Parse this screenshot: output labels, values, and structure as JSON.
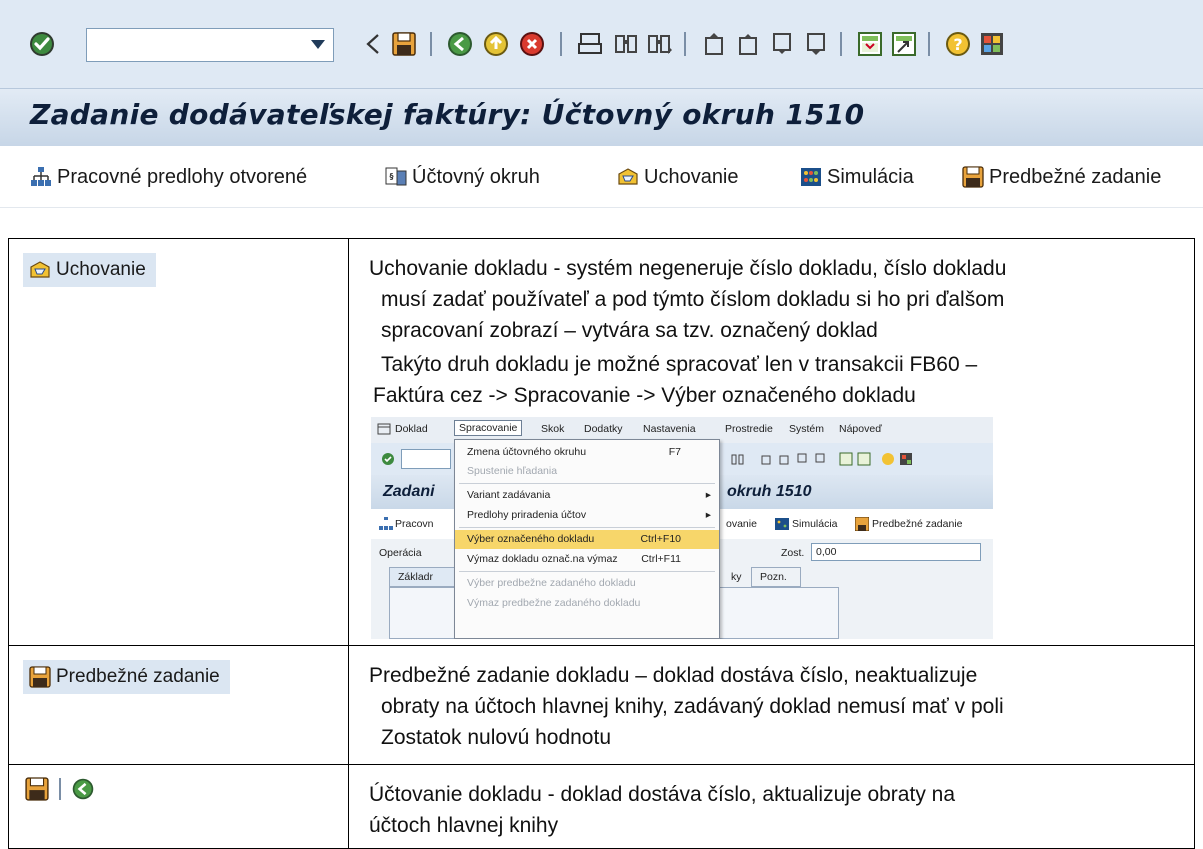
{
  "window": {
    "title": "Zadanie dodávateľskej faktúry: Účtovný okruh 1510"
  },
  "toolbar": {
    "command_value": "",
    "icons": [
      "enter-icon",
      "back-icon",
      "save-icon",
      "back-green-icon",
      "exit-icon",
      "cancel-icon",
      "print-icon",
      "find-icon",
      "find-next-icon",
      "first-page-icon",
      "previous-page-icon",
      "next-page-icon",
      "last-page-icon",
      "new-session-icon",
      "shortcut-icon",
      "help-icon",
      "layout-icon"
    ]
  },
  "app_toolbar": {
    "buttons": [
      {
        "label": "Pracovné predlohy otvorené",
        "icon": "tree-icon"
      },
      {
        "label": "Účtovný okruh",
        "icon": "company-code-icon"
      },
      {
        "label": "Uchovanie",
        "icon": "park-icon"
      },
      {
        "label": "Simulácia",
        "icon": "simulate-icon"
      },
      {
        "label": "Predbežné zadanie",
        "icon": "save-icon"
      }
    ]
  },
  "table": {
    "rows": [
      {
        "button_label": "Uchovanie",
        "description": [
          "Uchovanie dokladu -  systém negeneruje číslo dokladu, číslo dokladu",
          "musí zadať používateľ a pod týmto číslom dokladu si ho pri ďalšom",
          "spracovaní zobrazí – vytvára sa tzv. označený doklad",
          "Takýto druh dokladu je možné spracovať len v transakcii FB60 –",
          "Faktúra cez  -> Spracovanie -> Výber označeného dokladu"
        ]
      },
      {
        "button_label": "Predbežné zadanie",
        "description": [
          "Predbežné zadanie dokladu – doklad dostáva číslo, neaktualizuje",
          "obraty na účtoch hlavnej knihy, zadávaný doklad nemusí mať v poli",
          "Zostatok nulovú hodnotu"
        ]
      },
      {
        "button_label": "",
        "description": [
          "Účtovanie dokladu - doklad dostáva číslo, aktualizuje obraty na",
          "účtoch hlavnej knihy"
        ]
      }
    ]
  },
  "inset": {
    "menu": [
      "Doklad",
      "Spracovanie",
      "Skok",
      "Dodatky",
      "Nastavenia",
      "Prostredie",
      "Systém",
      "Nápoveď"
    ],
    "title": "Zadani",
    "title_right": "okruh 1510",
    "btn_left": "Pracovn",
    "btn_right": [
      "ovanie",
      "Simulácia",
      "Predbežné zadanie"
    ],
    "operation_label": "Operácia",
    "zost_label": "Zost.",
    "zost_value": "0,00",
    "tab_left": "Základr",
    "tab_right": [
      "ky",
      "Pozn."
    ],
    "dropdown": [
      {
        "label": "Zmena účtovného okruhu",
        "accel": "F7",
        "state": "normal"
      },
      {
        "label": "Spustenie hľadania",
        "accel": "",
        "state": "disabled"
      },
      {
        "label": "Variant zadávania",
        "accel": "",
        "state": "submenu"
      },
      {
        "label": "Predlohy priradenia účtov",
        "accel": "",
        "state": "submenu"
      },
      {
        "label": "Výber označeného dokladu",
        "accel": "Ctrl+F10",
        "state": "highlight"
      },
      {
        "label": "Výmaz dokladu označ.na výmaz",
        "accel": "Ctrl+F11",
        "state": "normal"
      },
      {
        "label": "Výber predbežne zadaného dokladu",
        "accel": "",
        "state": "disabled"
      },
      {
        "label": "Výmaz predbežne zadaného dokladu",
        "accel": "",
        "state": "disabled"
      }
    ]
  },
  "colors": {
    "toolbar_bg": "#dfe9f4",
    "title_bg": "#c7d6e7",
    "highlight": "#f7d66a",
    "save_orange": "#e8a33c",
    "green": "#2e8b3a"
  }
}
